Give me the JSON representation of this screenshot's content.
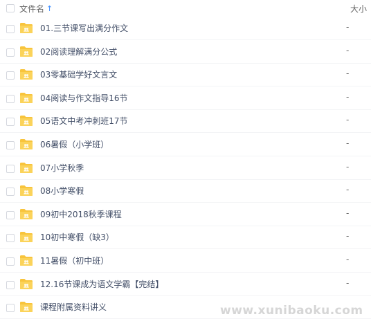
{
  "header": {
    "name_label": "文件名",
    "sort_icon": "arrow-up-icon",
    "size_label": "大小"
  },
  "folder_color": "#f8c43c",
  "rows": [
    {
      "name": "01.三节课写出满分作文",
      "size": "-"
    },
    {
      "name": "02阅读理解满分公式",
      "size": "-"
    },
    {
      "name": "03零基础学好文言文",
      "size": "-"
    },
    {
      "name": "04阅读与作文指导16节",
      "size": "-"
    },
    {
      "name": "05语文中考冲刺班17节",
      "size": "-"
    },
    {
      "name": "06暑假（小学班）",
      "size": "-"
    },
    {
      "name": "07小学秋季",
      "size": "-"
    },
    {
      "name": "08小学寒假",
      "size": "-"
    },
    {
      "name": "09初中2018秋季课程",
      "size": "-"
    },
    {
      "name": "10初中寒假（缺3）",
      "size": "-"
    },
    {
      "name": "11暑假（初中班）",
      "size": "-"
    },
    {
      "name": "12.16节课成为语文学霸【完结】",
      "size": "-"
    },
    {
      "name": "课程附属资料讲义",
      "size": ""
    }
  ],
  "watermark": "www.xunibaoku.com"
}
